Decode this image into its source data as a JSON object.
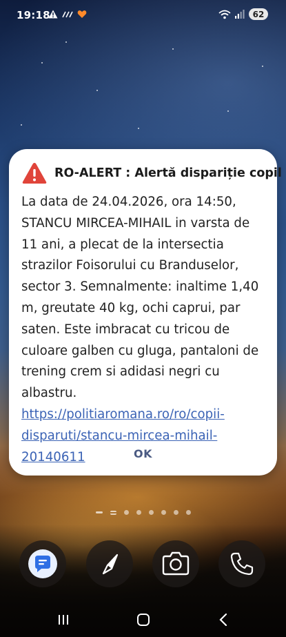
{
  "status_bar": {
    "time": "19:18",
    "battery": "62",
    "left_icons": [
      "warning-icon",
      "data-speed-icon",
      "heart-app-icon"
    ],
    "right_icons": [
      "wifi-icon",
      "signal-icon"
    ]
  },
  "alert": {
    "title": "RO-ALERT : Alertă dispariție copil",
    "body": "La data de 24.04.2026, ora 14:50, STANCU MIRCEA-MIHAIL in varsta de 11 ani, a plecat de la intersectia strazilor Foisorului cu Branduselor, sector 3. Semnalmente: inaltime 1,40 m, greutate 40 kg, ochi caprui, par saten. Este imbracat cu tricou de culoare galben cu gluga, pantaloni de trening crem si adidasi negri cu albastru.",
    "link": "https://politiaromana.ro/ro/copii-disparuti/stancu-mircea-mihail-20140611",
    "ok_label": "OK",
    "icon": "warning-triangle-icon",
    "accent_color": "#e0443a"
  },
  "home": {
    "page_dots": 7,
    "dock": [
      "messages-icon",
      "compass-icon",
      "camera-icon",
      "phone-icon"
    ]
  },
  "nav": [
    "recents-icon",
    "home-icon",
    "back-icon"
  ]
}
